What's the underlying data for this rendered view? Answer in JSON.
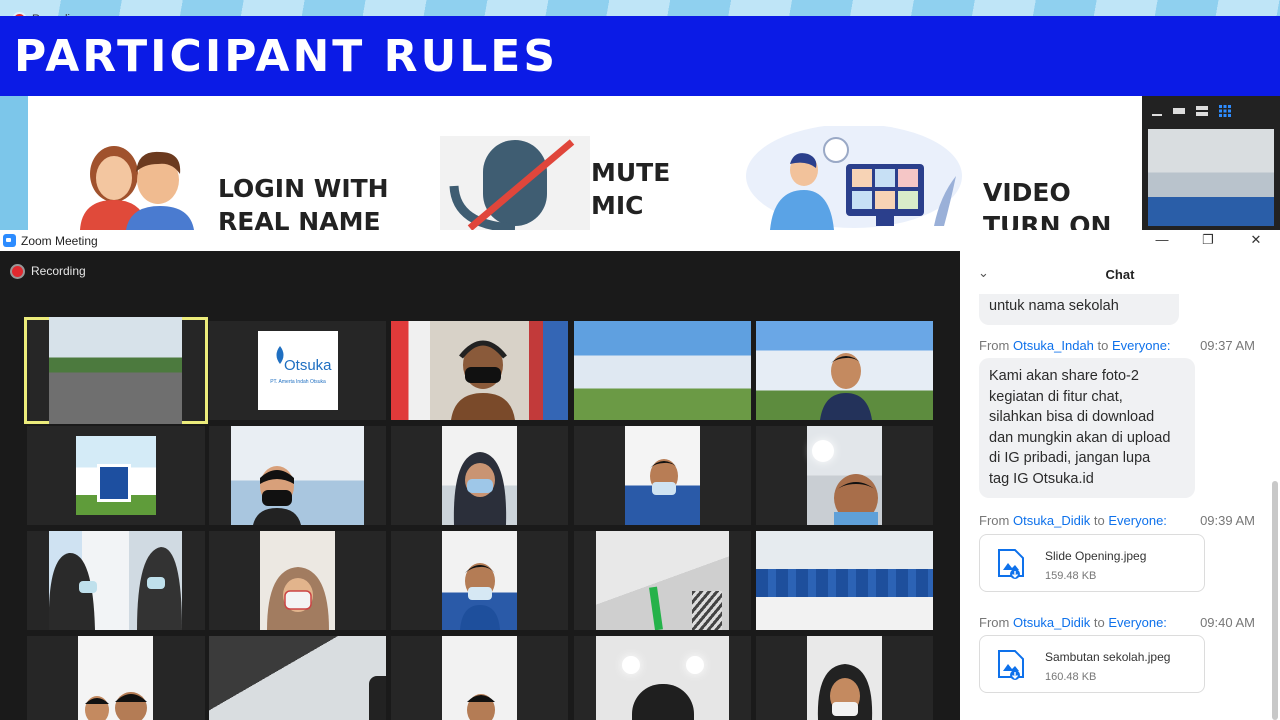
{
  "slide": {
    "recording_label": "Recording",
    "title": "PARTICIPANT RULES",
    "rules": [
      {
        "line1": "LOGIN WITH",
        "line2": "REAL NAME"
      },
      {
        "line1": "MUTE",
        "line2": "MIC"
      },
      {
        "line1": "VIDEO",
        "line2": "TURN ON"
      }
    ]
  },
  "window": {
    "title": "Zoom Meeting",
    "minimize": "—",
    "restore": "❐",
    "close": "✕"
  },
  "gallery": {
    "recording_label": "Recording",
    "tile_logo_text": "Otsuka",
    "tile_logo_sub": "PT. Amerta Indah Otsuka"
  },
  "chat": {
    "title": "Chat",
    "collapse_icon": "⌄",
    "prev_message_tail": "untuk nama sekolah",
    "messages": [
      {
        "from_label": "From",
        "sender": "Otsuka_Indah",
        "to_label": "to",
        "recipient": "Everyone:",
        "time": "09:37 AM",
        "lines": [
          "Kami akan share foto-2",
          "kegiatan di fitur chat,",
          "silahkan bisa di download",
          "dan mungkin akan di upload",
          "di IG pribadi, jangan lupa",
          "tag IG Otsuka.id"
        ]
      },
      {
        "from_label": "From",
        "sender": "Otsuka_Didik",
        "to_label": "to",
        "recipient": "Everyone:",
        "time": "09:39 AM",
        "file_name": "Slide Opening.jpeg",
        "file_size": "159.48 KB"
      },
      {
        "from_label": "From",
        "sender": "Otsuka_Didik",
        "to_label": "to",
        "recipient": "Everyone:",
        "time": "09:40 AM",
        "file_name": "Sambutan sekolah.jpeg",
        "file_size": "160.48 KB"
      }
    ]
  },
  "colors": {
    "banner_blue": "#0b1be6",
    "zoom_blue": "#2d8cff",
    "chat_link": "#0e71eb",
    "active_speaker": "#ecec7b",
    "recording_red": "#e0292f"
  }
}
